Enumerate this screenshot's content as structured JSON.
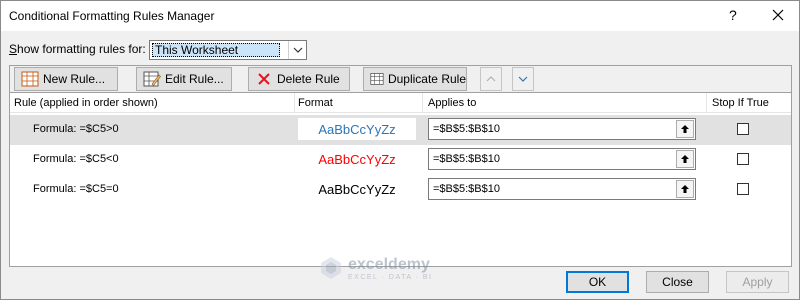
{
  "dialog": {
    "title": "Conditional Formatting Rules Manager",
    "help_label": "?"
  },
  "scope": {
    "label_prefix": "S",
    "label_rest": "how formatting rules for:",
    "selected": "This Worksheet"
  },
  "toolbar": {
    "new_rule": "New Rule...",
    "edit_rule": "Edit Rule...",
    "delete_rule": "Delete Rule",
    "duplicate_rule": "Duplicate Rule"
  },
  "table": {
    "headers": {
      "rule": "Rule (applied in order shown)",
      "format": "Format",
      "applies_to": "Applies to",
      "stop_if_true": "Stop If True"
    },
    "rows": [
      {
        "formula": "Formula: =$C5>0",
        "preview": "AaBbCcYyZz",
        "preview_color": "#2e75b6",
        "applies_to": "=$B$5:$B$10",
        "stop_if_true": false
      },
      {
        "formula": "Formula: =$C5<0",
        "preview": "AaBbCcYyZz",
        "preview_color": "#ff0000",
        "applies_to": "=$B$5:$B$10",
        "stop_if_true": false
      },
      {
        "formula": "Formula: =$C5=0",
        "preview": "AaBbCcYyZz",
        "preview_color": "#000000",
        "applies_to": "=$B$5:$B$10",
        "stop_if_true": false
      }
    ]
  },
  "watermark": {
    "name": "exceldemy",
    "tagline": "EXCEL · DATA · BI"
  },
  "buttons": {
    "ok": "OK",
    "close": "Close",
    "apply": "Apply"
  }
}
